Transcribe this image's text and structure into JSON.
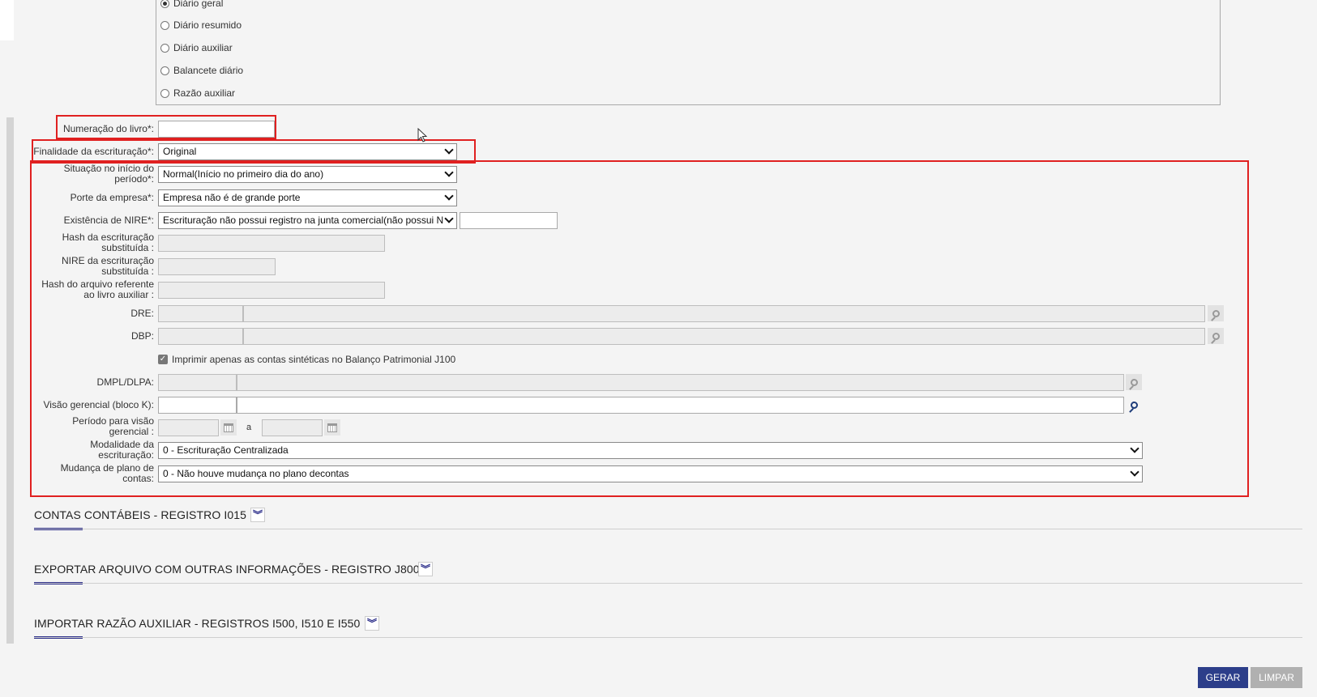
{
  "radios": [
    {
      "label": "Diário geral",
      "checked": true
    },
    {
      "label": "Diário resumido",
      "checked": false
    },
    {
      "label": "Diário auxiliar",
      "checked": false
    },
    {
      "label": "Balancete diário",
      "checked": false
    },
    {
      "label": "Razão auxiliar",
      "checked": false
    }
  ],
  "form": {
    "numeracao_label": "Numeração do livro*:",
    "numeracao_value": "",
    "finalidade_label": "Finalidade da escrituração*:",
    "finalidade_value": "Original",
    "situacao_label_1": "Situação no início do",
    "situacao_label_2": "período*:",
    "situacao_value": "Normal(Início no primeiro dia do ano)",
    "porte_label": "Porte da empresa*:",
    "porte_value": "Empresa não é de grande porte",
    "nire_label": "Existência de NIRE*:",
    "nire_value": "Escrituração não possui registro na junta comercial(não possui N",
    "hash_subst_label_1": "Hash da escrituração",
    "hash_subst_label_2": "substituída :",
    "nire_subst_label_1": "NIRE da escrituração",
    "nire_subst_label_2": "substituída :",
    "hash_aux_label_1": "Hash do arquivo referente",
    "hash_aux_label_2": "ao livro auxiliar :",
    "dre_label": "DRE:",
    "dbp_label": "DBP:",
    "imprimir_label": "Imprimir apenas as contas sintéticas no Balanço Patrimonial J100",
    "imprimir_checked": true,
    "dmpl_label": "DMPL/DLPA:",
    "visao_label": "Visão gerencial (bloco K):",
    "periodo_label_1": "Período para visão",
    "periodo_label_2": "gerencial :",
    "periodo_sep": "a",
    "modalidade_label_1": "Modalidade da",
    "modalidade_label_2": "escrituração:",
    "modalidade_value": "0 - Escrituração Centralizada",
    "mudanca_label_1": "Mudança de plano de",
    "mudanca_label_2": "contas:",
    "mudanca_value": "0 - Não houve mudança no plano decontas"
  },
  "sections": [
    {
      "title": "CONTAS CONTÁBEIS - REGISTRO I015"
    },
    {
      "title": "EXPORTAR ARQUIVO COM OUTRAS INFORMAÇÕES - REGISTRO J800"
    },
    {
      "title": "IMPORTAR RAZÃO AUXILIAR - REGISTROS I500, I510 E I550"
    }
  ],
  "buttons": {
    "gerar": "GERAR",
    "limpar": "LIMPAR"
  },
  "icons": {
    "expand": "chevron-double-down-icon",
    "search": "search-icon",
    "calendar": "calendar-icon"
  },
  "colors": {
    "highlight": "#e02020",
    "primary": "#2c3e8a",
    "disabled_button": "#b0b0b0"
  }
}
